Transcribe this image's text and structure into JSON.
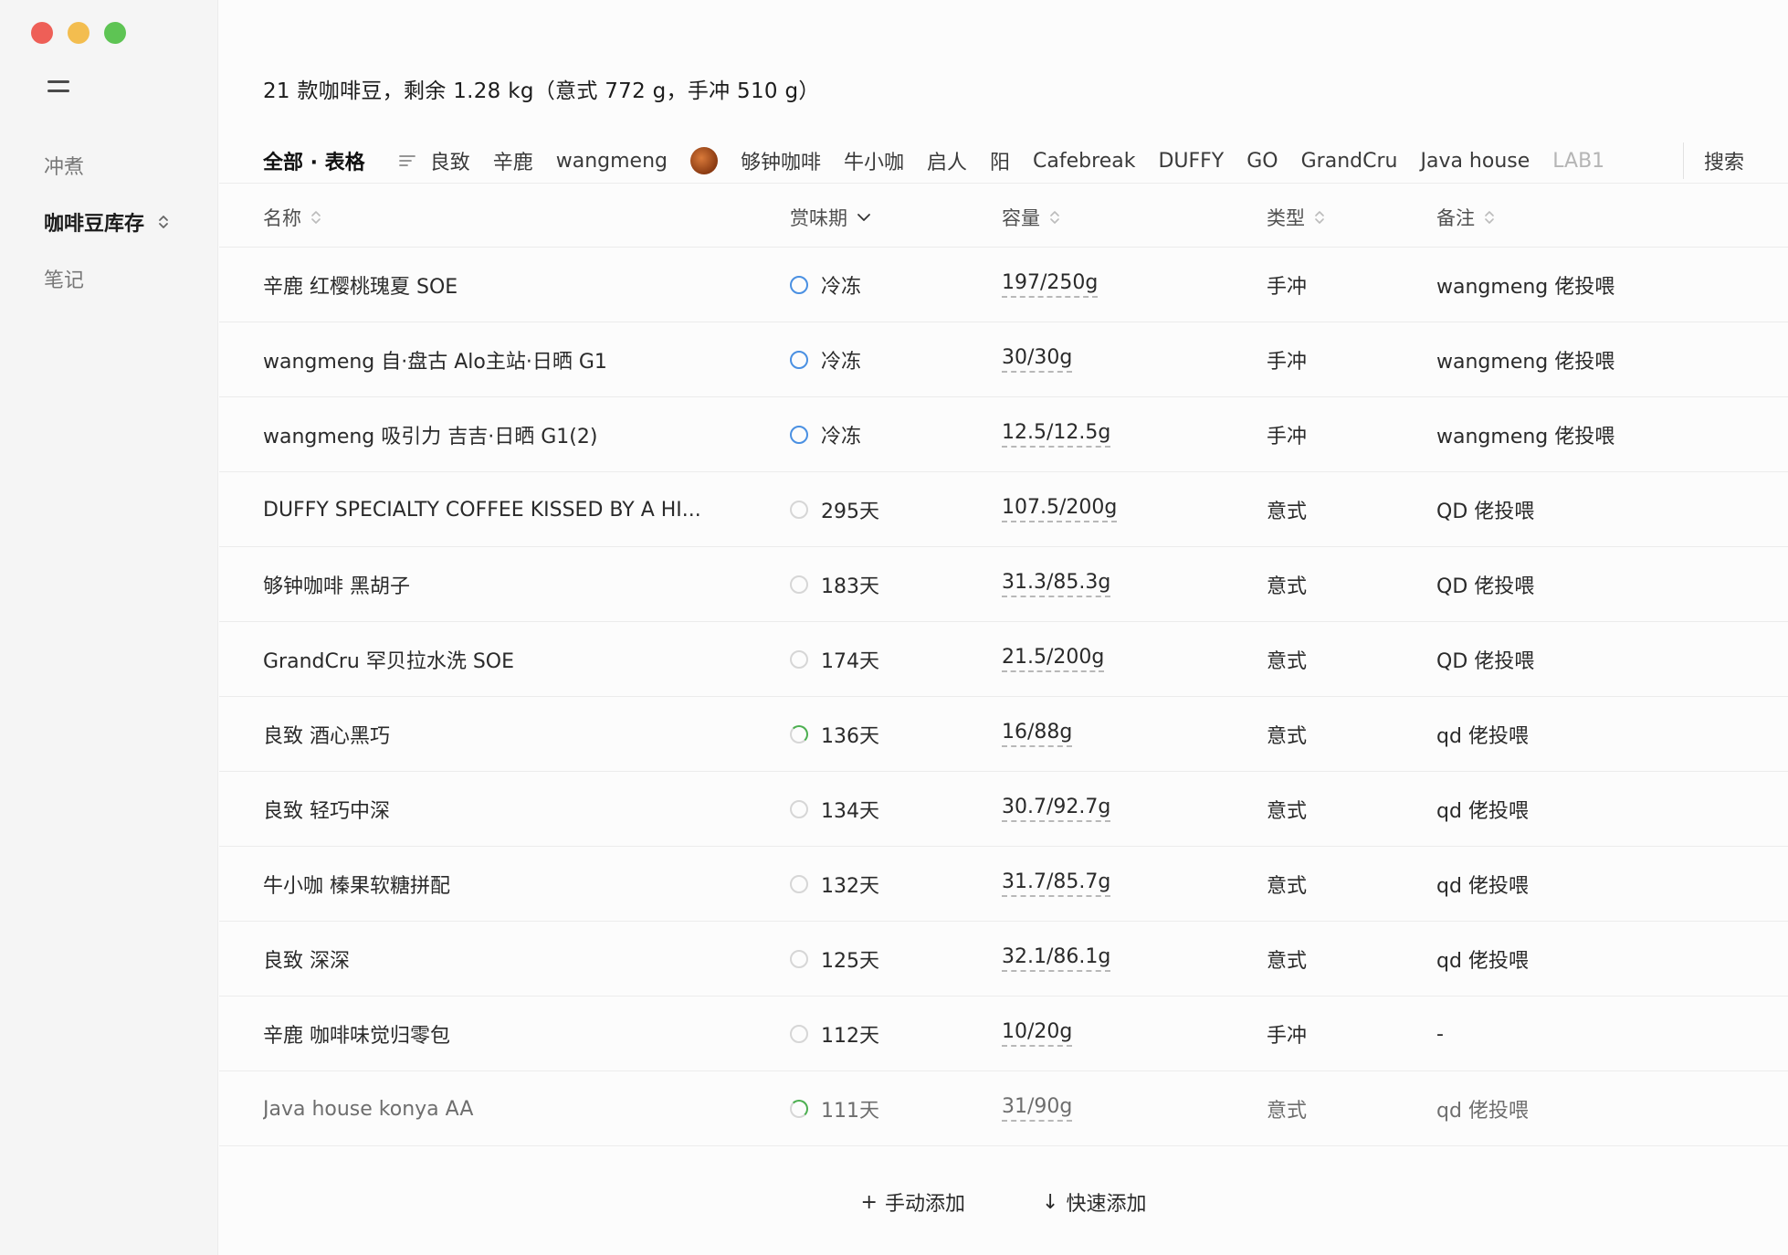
{
  "sidebar": {
    "items": [
      {
        "label": "冲煮"
      },
      {
        "label": "咖啡豆库存"
      },
      {
        "label": "笔记"
      }
    ]
  },
  "summary": "21 款咖啡豆，剩余 1.28 kg（意式 772 g，手冲 510 g）",
  "filters": {
    "all_label": "全部 · 表格",
    "items": [
      "良致",
      "辛鹿",
      "wangmeng",
      "够钟咖啡",
      "牛小咖",
      "启人",
      "阳",
      "Cafebreak",
      "DUFFY",
      "GO",
      "GrandCru",
      "Java house",
      "LAB1"
    ],
    "emoji_icon": "coffee-bean-icon",
    "search_label": "搜索"
  },
  "table": {
    "columns": {
      "name": "名称",
      "shelf": "赏味期",
      "capacity": "容量",
      "type": "类型",
      "note": "备注"
    },
    "rows": [
      {
        "name": "辛鹿 红樱桃瑰夏 SOE",
        "status": "frozen",
        "shelf": "冷冻",
        "capacity": "197/250g",
        "type": "手冲",
        "note": "wangmeng 佬投喂"
      },
      {
        "name": "wangmeng 自·盘古 Alo主站·日晒 G1",
        "status": "frozen",
        "shelf": "冷冻",
        "capacity": "30/30g",
        "type": "手冲",
        "note": "wangmeng 佬投喂"
      },
      {
        "name": "wangmeng 吸引力 吉吉·日晒 G1(2)",
        "status": "frozen",
        "shelf": "冷冻",
        "capacity": "12.5/12.5g",
        "type": "手冲",
        "note": "wangmeng 佬投喂"
      },
      {
        "name": "DUFFY SPECIALTY COFFEE KISSED BY A HI...",
        "status": "empty",
        "shelf": "295天",
        "capacity": "107.5/200g",
        "type": "意式",
        "note": "QD 佬投喂"
      },
      {
        "name": "够钟咖啡 黑胡子",
        "status": "empty",
        "shelf": "183天",
        "capacity": "31.3/85.3g",
        "type": "意式",
        "note": "QD 佬投喂"
      },
      {
        "name": "GrandCru 罕贝拉水洗 SOE",
        "status": "empty",
        "shelf": "174天",
        "capacity": "21.5/200g",
        "type": "意式",
        "note": "QD 佬投喂"
      },
      {
        "name": "良致 酒心黑巧",
        "status": "partial",
        "shelf": "136天",
        "capacity": "16/88g",
        "type": "意式",
        "note": "qd 佬投喂"
      },
      {
        "name": "良致 轻巧中深",
        "status": "empty",
        "shelf": "134天",
        "capacity": "30.7/92.7g",
        "type": "意式",
        "note": "qd 佬投喂"
      },
      {
        "name": "牛小咖 榛果软糖拼配",
        "status": "empty",
        "shelf": "132天",
        "capacity": "31.7/85.7g",
        "type": "意式",
        "note": "qd 佬投喂"
      },
      {
        "name": "良致 深深",
        "status": "empty",
        "shelf": "125天",
        "capacity": "32.1/86.1g",
        "type": "意式",
        "note": "qd 佬投喂"
      },
      {
        "name": "辛鹿 咖啡味觉归零包",
        "status": "empty",
        "shelf": "112天",
        "capacity": "10/20g",
        "type": "手冲",
        "note": "-"
      },
      {
        "name": "Java house konya AA",
        "status": "partial",
        "shelf": "111天",
        "capacity": "31/90g",
        "type": "意式",
        "note": "qd 佬投喂"
      }
    ]
  },
  "bottom": {
    "manual_add": "手动添加",
    "quick_add": "快速添加"
  },
  "colors": {
    "frozen_ring": "#4a90e2",
    "partial_ring": "#4caf50",
    "traffic_red": "#ee5f57",
    "traffic_yellow": "#f3bd4f",
    "traffic_green": "#5ec454"
  }
}
